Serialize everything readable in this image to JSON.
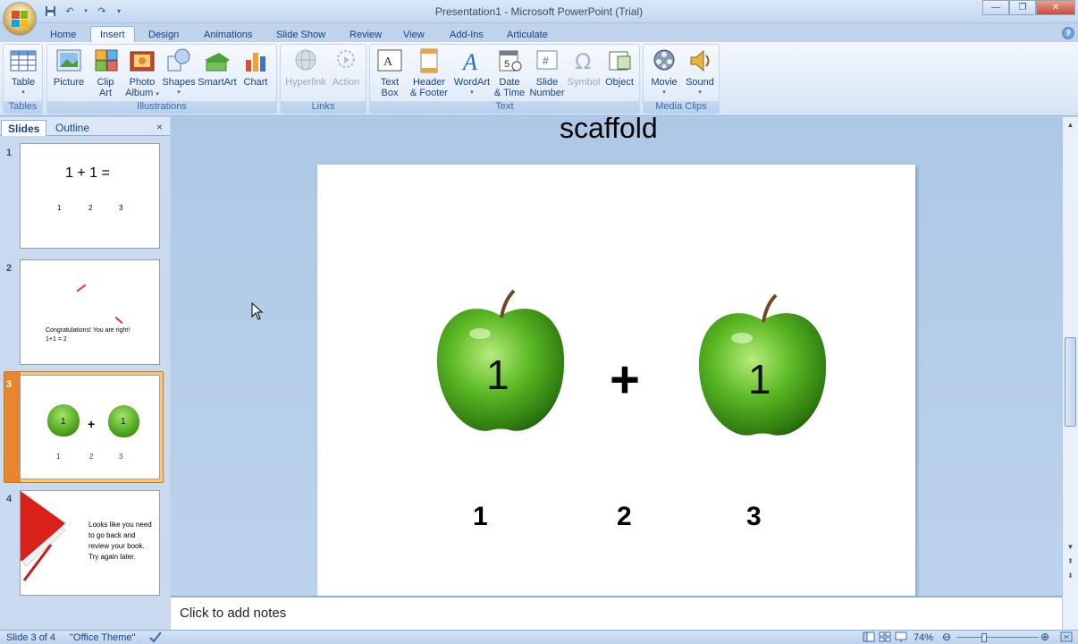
{
  "window": {
    "title": "Presentation1 - Microsoft PowerPoint (Trial)"
  },
  "quick_access": {
    "icons": [
      "save-icon",
      "undo-icon",
      "redo-icon",
      "customize-icon"
    ]
  },
  "tabs": [
    "Home",
    "Insert",
    "Design",
    "Animations",
    "Slide Show",
    "Review",
    "View",
    "Add-Ins",
    "Articulate"
  ],
  "active_tab": "Insert",
  "ribbon": {
    "groups": {
      "tables": "Tables",
      "illustrations": "Illustrations",
      "links": "Links",
      "text": "Text",
      "media": "Media Clips"
    },
    "buttons": {
      "table": "Table",
      "picture": "Picture",
      "clipart_1": "Clip",
      "clipart_2": "Art",
      "photo_1": "Photo",
      "photo_2": "Album",
      "shapes": "Shapes",
      "smartart": "SmartArt",
      "chart": "Chart",
      "hyperlink": "Hyperlink",
      "action": "Action",
      "textbox_1": "Text",
      "textbox_2": "Box",
      "header_1": "Header",
      "header_2": "& Footer",
      "wordart": "WordArt",
      "date_1": "Date",
      "date_2": "& Time",
      "slidenum_1": "Slide",
      "slidenum_2": "Number",
      "symbol": "Symbol",
      "object": "Object",
      "movie": "Movie",
      "sound": "Sound"
    }
  },
  "pane": {
    "tab_slides": "Slides",
    "tab_outline": "Outline",
    "close": "×"
  },
  "thumbnails": [
    {
      "number": "1",
      "title": "1 + 1 =",
      "opts": [
        "1",
        "2",
        "3"
      ]
    },
    {
      "number": "2",
      "text": "Congratulations! You are right! 1+1 = 2"
    },
    {
      "number": "3",
      "plus": "+",
      "apple_label": "1",
      "opts": [
        "1",
        "2",
        "3"
      ]
    },
    {
      "number": "4",
      "text": "Looks like you need to go back and review your book.  Try again later."
    }
  ],
  "slide": {
    "prev_title_fragment": "scaffold",
    "apple_left_label": "1",
    "plus": "+",
    "apple_right_label": "1",
    "answers": [
      "1",
      "2",
      "3"
    ]
  },
  "notes": {
    "placeholder": "Click to add notes"
  },
  "status": {
    "slide_info": "Slide 3 of 4",
    "theme": "\"Office Theme\"",
    "zoom": "74%"
  },
  "colors": {
    "ribbon_bg": "#e3edf9",
    "accent": "#15428b",
    "selected_thumb": "#f8c874",
    "apple_green": "#5fbf2a"
  }
}
